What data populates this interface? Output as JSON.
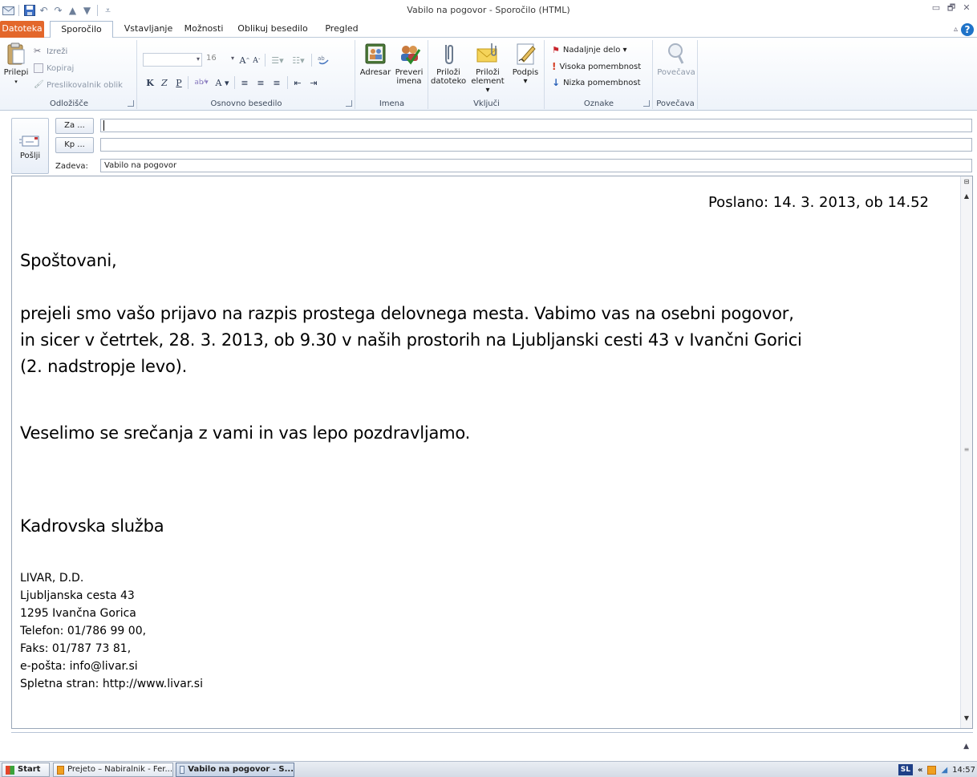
{
  "window": {
    "title": "Vabilo na pogovor - Sporočilo (HTML)",
    "controls": {
      "minimize": "▭",
      "restore": "🗗",
      "close": "✕"
    }
  },
  "tabs": [
    {
      "label": "Datoteka"
    },
    {
      "label": "Sporočilo"
    },
    {
      "label": "Vstavljanje"
    },
    {
      "label": "Možnosti"
    },
    {
      "label": "Oblikuj besedilo"
    },
    {
      "label": "Pregled"
    }
  ],
  "ribbon": {
    "clipboard": {
      "label": "Odložišče",
      "paste": "Prilepi",
      "cut": "Izreži",
      "copy": "Kopiraj",
      "painter": "Preslikovalnik oblik"
    },
    "text": {
      "label": "Osnovno besedilo",
      "font_size": "16",
      "bold": "K",
      "italic": "Z",
      "underline": "P"
    },
    "names": {
      "label": "Imena",
      "address_book": "Adresar",
      "check_names_1": "Preveri",
      "check_names_2": "imena"
    },
    "include": {
      "label": "Vključi",
      "attach_file_1": "Priloži",
      "attach_file_2": "datoteko",
      "attach_item_1": "Priloži",
      "attach_item_2": "element ▾",
      "signature": "Podpis",
      "signature_arrow": "▾"
    },
    "tags": {
      "label": "Oznake",
      "followup": "Nadaljnje delo ▾",
      "high": "Visoka pomembnost",
      "low": "Nizka pomembnost"
    },
    "zoom": {
      "label": "Povečava",
      "zoom_btn": "Povečava"
    }
  },
  "header": {
    "send": "Pošlji",
    "to_btn": "Za ...",
    "to_value": "",
    "cc_btn": "Kp ...",
    "cc_value": "",
    "subject_label": "Zadeva:",
    "subject_value": "Vabilo na pogovor"
  },
  "message": {
    "sent": "Poslano: 14. 3. 2013, ob 14.52",
    "greeting": "Spoštovani,",
    "para1_line1": "prejeli smo vašo prijavo na razpis prostega delovnega mesta. Vabimo vas na osebni pogovor,",
    "para1_line2": "in sicer v četrtek, 28. 3. 2013, ob 9.30 v naših prostorih na Ljubljanski cesti 43 v Ivančni Gorici",
    "para1_line3": "(2. nadstropje levo).",
    "closing": "Veselimo se srečanja z vami in vas lepo pozdravljamo.",
    "sender": "Kadrovska služba",
    "signature": [
      "LIVAR, D.D.",
      "Ljubljanska cesta 43",
      "1295 Ivančna Gorica",
      "Telefon: 01/786 99 00,",
      "Faks: 01/787 73 81,",
      "e-pošta: info@livar.si",
      "Spletna stran: http://www.livar.si"
    ]
  },
  "taskbar": {
    "start": "Start",
    "task1": "Prejeto – Nabiralnik - Fer...",
    "task2": "Vabilo na pogovor - S...",
    "lang": "SL",
    "tray_arrows": "«",
    "clock": "14:57"
  },
  "colors": {
    "file_tab": "#e3672b",
    "ribbon_border": "#bccad9",
    "accent_blue": "#1f73c8"
  }
}
